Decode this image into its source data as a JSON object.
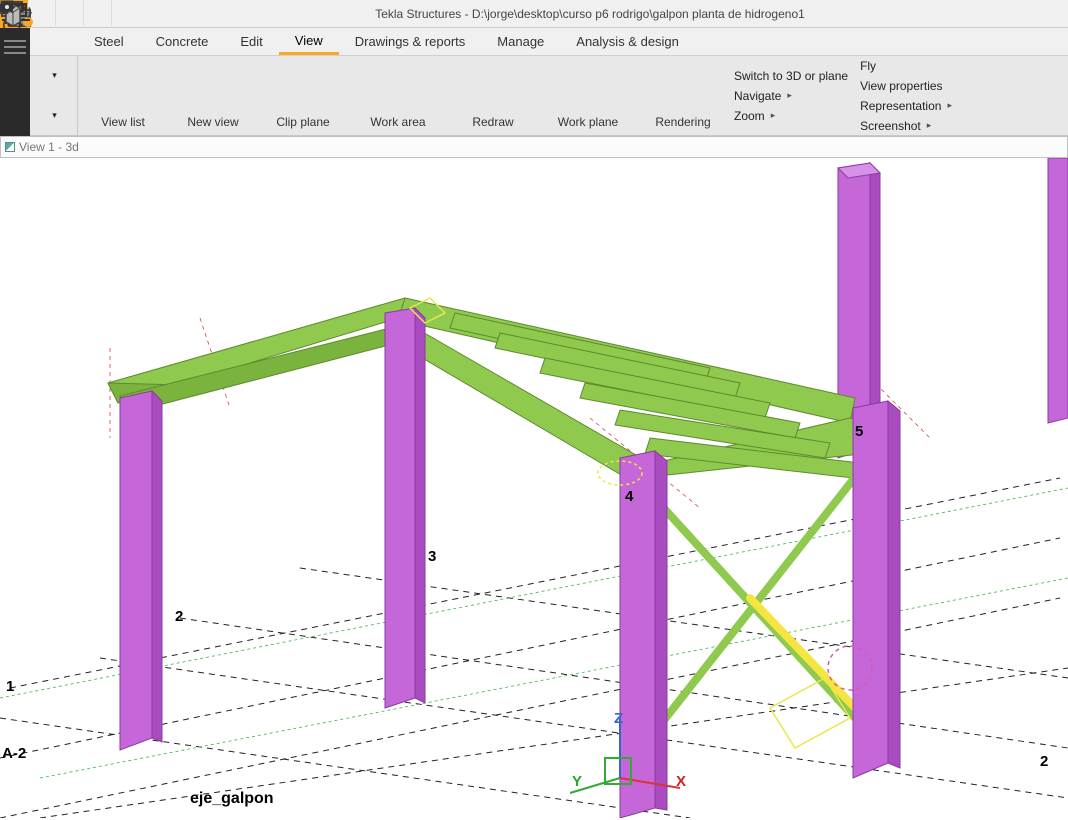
{
  "title": "Tekla Structures - D:\\jorge\\desktop\\curso p6 rodrigo\\galpon planta de hidrogeno1",
  "menu": {
    "steel": "Steel",
    "concrete": "Concrete",
    "edit": "Edit",
    "view": "View",
    "drawings": "Drawings & reports",
    "manage": "Manage",
    "analysis": "Analysis & design"
  },
  "ribbon": {
    "view_list": "View list",
    "new_view": "New view",
    "clip_plane": "Clip plane",
    "work_area": "Work area",
    "redraw": "Redraw",
    "work_plane": "Work plane",
    "rendering": "Rendering"
  },
  "side1": {
    "switch": "Switch to 3D or plane",
    "navigate": "Navigate",
    "zoom": "Zoom"
  },
  "side2": {
    "fly": "Fly",
    "viewprops": "View properties",
    "representation": "Representation",
    "screenshot": "Screenshot"
  },
  "viewport_title": "View 1 - 3d",
  "grid": {
    "l1": "1",
    "l2": "2",
    "l3": "3",
    "l4": "4",
    "l5": "5",
    "la2": "A-2",
    "r2": "2",
    "eje": "eje_galpon"
  },
  "axes": {
    "x": "X",
    "y": "Y",
    "z": "Z"
  }
}
